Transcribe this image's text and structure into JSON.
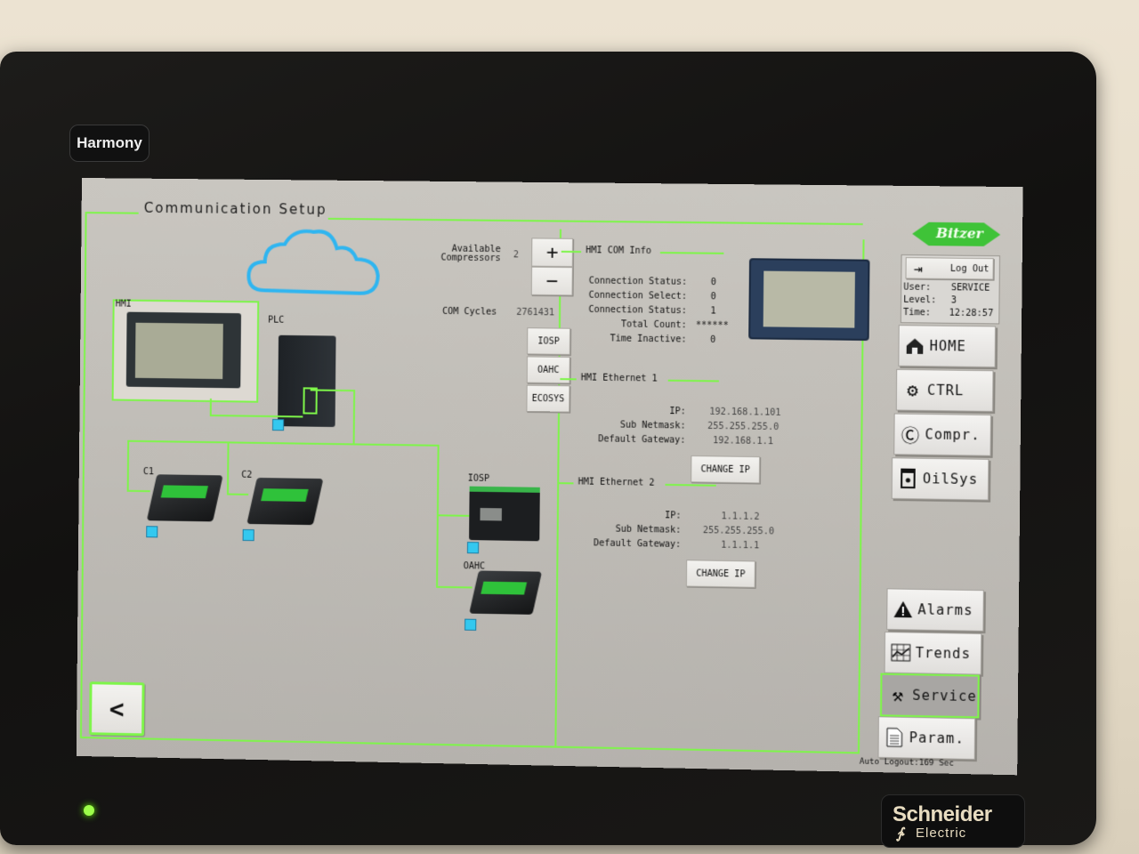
{
  "device": {
    "harmony_label": "Harmony",
    "brand_name": "Schneider",
    "brand_sub": "Electric"
  },
  "screen": {
    "title": "Communication Setup",
    "logo_text": "Bitzer",
    "diagram": {
      "hmi_label": "HMI",
      "plc_label": "PLC",
      "c1_label": "C1",
      "c2_label": "C2",
      "iosp_label": "IOSP",
      "oahc_label": "OAHC",
      "cloud_color": "#2fb5f0",
      "line_color": "#7ef54a",
      "status_color": "#33c8ef"
    },
    "compressors": {
      "available_label_1": "Available",
      "available_label_2": "Compressors",
      "available_value": "2",
      "plus_label": "+",
      "minus_label": "−",
      "com_cycles_label": "COM Cycles",
      "com_cycles_value": "2761431"
    },
    "device_buttons": [
      "IOSP",
      "OAHC",
      "ECOSYS"
    ],
    "com_info": {
      "heading": "HMI COM Info",
      "rows": [
        {
          "label": "Connection Status:",
          "value": "0"
        },
        {
          "label": "Connection Select:",
          "value": "0"
        },
        {
          "label": "Connection Status:",
          "value": "1"
        },
        {
          "label": "Total Count:",
          "value": "******"
        },
        {
          "label": "Time Inactive:",
          "value": "0"
        }
      ]
    },
    "ethernet1": {
      "heading": "HMI Ethernet 1",
      "ip_label": "IP:",
      "ip": "192.168.1.101",
      "netmask_label": "Sub Netmask:",
      "netmask": "255.255.255.0",
      "gateway_label": "Default Gateway:",
      "gateway": "192.168.1.1",
      "button": "CHANGE IP"
    },
    "ethernet2": {
      "heading": "HMI Ethernet 2",
      "ip_label": "IP:",
      "ip": "1.1.1.2",
      "netmask_label": "Sub Netmask:",
      "netmask": "255.255.255.0",
      "gateway_label": "Default Gateway:",
      "gateway": "1.1.1.1",
      "button": "CHANGE IP"
    },
    "user": {
      "logout_label": "Log Out",
      "user_label": "User:",
      "user_value": "SERVICE",
      "level_label": "Level:",
      "level_value": "3",
      "time_label": "Time:",
      "time_value": "12:28:57"
    },
    "nav_top": [
      {
        "label": "HOME",
        "icon": "home-icon"
      },
      {
        "label": "CTRL",
        "icon": "gears-icon"
      },
      {
        "label": "Compr.",
        "icon": "compressor-icon"
      },
      {
        "label": "OilSys",
        "icon": "oil-icon"
      }
    ],
    "nav_bottom": [
      {
        "label": "Alarms",
        "icon": "warning-icon"
      },
      {
        "label": "Trends",
        "icon": "trend-chart-icon"
      },
      {
        "label": "Service",
        "icon": "tools-icon",
        "active": true
      },
      {
        "label": "Param.",
        "icon": "document-icon"
      }
    ],
    "auto_logout": "Auto Logout:169 Sec",
    "back_label": "<"
  }
}
